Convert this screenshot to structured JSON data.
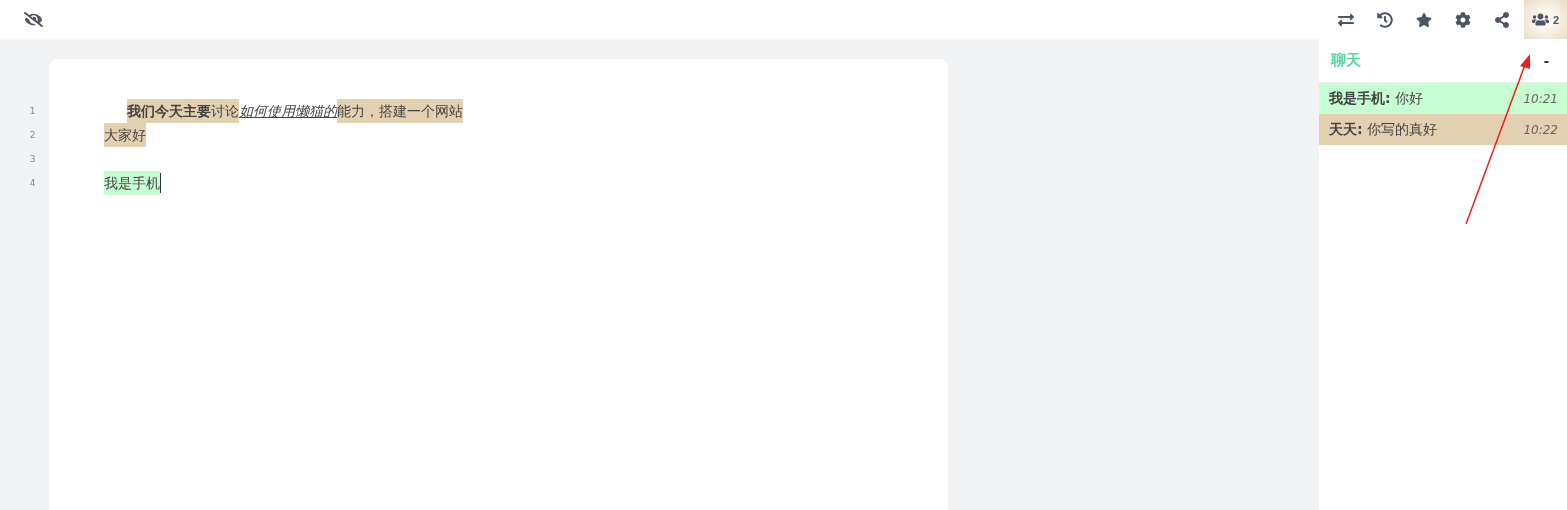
{
  "toolbar": {
    "users_count": "2",
    "users_selected": true
  },
  "editor": {
    "lines": [
      {
        "number": "1",
        "indent": true,
        "segments": [
          {
            "text": "我们今天主要",
            "bold": true,
            "italic": false,
            "color": "#e3d0b1"
          },
          {
            "text": "讨论",
            "bold": false,
            "italic": false,
            "color": "#e3d0b1"
          },
          {
            "text": "如何使用懒猫的",
            "bold": false,
            "italic": true,
            "color": "#ffffff"
          },
          {
            "text": "能力，搭建一个网站",
            "bold": false,
            "italic": false,
            "color": "#e3d0b1"
          }
        ]
      },
      {
        "number": "2",
        "indent": false,
        "segments": [
          {
            "text": "大家好",
            "bold": false,
            "italic": false,
            "color": "#e3d0b1"
          }
        ]
      },
      {
        "number": "3"
      },
      {
        "number": "4",
        "indent": false,
        "cursor": true,
        "segments": [
          {
            "text": "我是手机",
            "bold": false,
            "italic": false,
            "color": "#c6fdd3"
          }
        ]
      }
    ]
  },
  "chat": {
    "title": "聊天",
    "minimize": "-",
    "messages": [
      {
        "author": "我是手机:",
        "text": "你好",
        "time": "10:21",
        "color": "#c6fdd3"
      },
      {
        "author": "天天:",
        "text": "你写的真好",
        "time": "10:22",
        "color": "#e3d0b1"
      }
    ]
  }
}
